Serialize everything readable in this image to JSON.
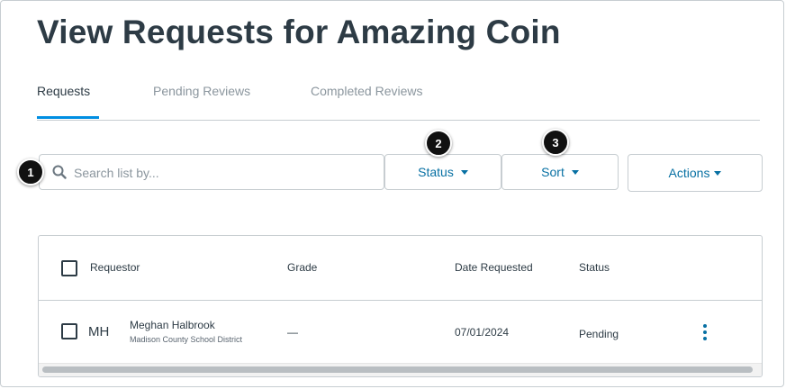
{
  "page": {
    "title": "View Requests for Amazing Coin"
  },
  "tabs": [
    {
      "label": "Requests",
      "active": true
    },
    {
      "label": "Pending Reviews",
      "active": false
    },
    {
      "label": "Completed Reviews",
      "active": false
    }
  ],
  "search": {
    "placeholder": "Search list by...",
    "value": "",
    "icon": "search-icon"
  },
  "toolbar": {
    "status_label": "Status",
    "sort_label": "Sort",
    "actions_label": "Actions"
  },
  "callouts": [
    "1",
    "2",
    "3"
  ],
  "table": {
    "headers": {
      "requestor": "Requestor",
      "grade": "Grade",
      "date": "Date Requested",
      "status": "Status"
    },
    "rows": [
      {
        "initials": "MH",
        "name": "Meghan Halbrook",
        "school": "Madison County School District",
        "grade": "—",
        "date": "07/01/2024",
        "status": "Pending"
      }
    ]
  },
  "colors": {
    "accent": "#0770a3",
    "tab_underline": "#008ee2",
    "text": "#2d3b45",
    "muted": "#8b969e",
    "border": "#c7cdd1"
  }
}
